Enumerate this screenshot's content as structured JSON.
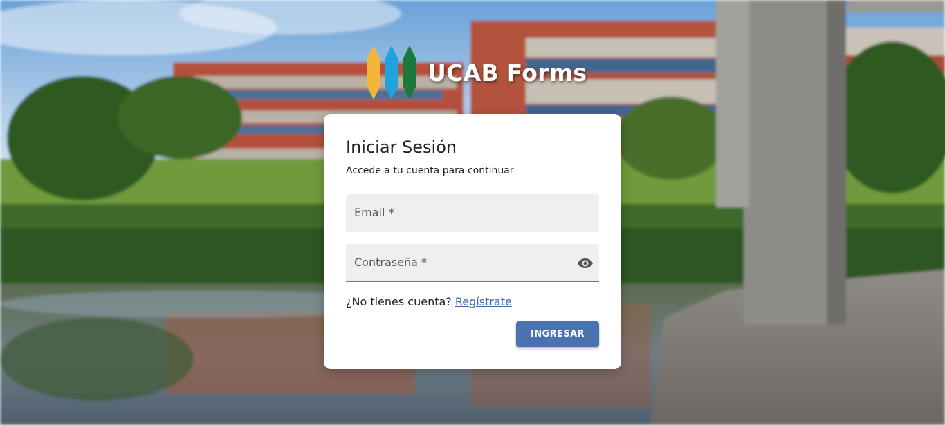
{
  "brand": {
    "name": "UCAB Forms",
    "logo_colors": [
      "#f3b63a",
      "#1ea3dc",
      "#1b7a3a"
    ]
  },
  "login": {
    "title": "Iniciar Sesión",
    "subtitle": "Accede a tu cuenta para continuar",
    "email_label": "Email *",
    "password_label": "Contraseña *",
    "no_account_text": "¿No tienes cuenta?",
    "register_link": "Regístrate",
    "submit_label": "INGRESAR"
  },
  "colors": {
    "accent": "#4a72b0",
    "link": "#3e6ab0",
    "field_bg": "#efefef"
  },
  "icons": {
    "password_toggle": "eye-icon"
  }
}
